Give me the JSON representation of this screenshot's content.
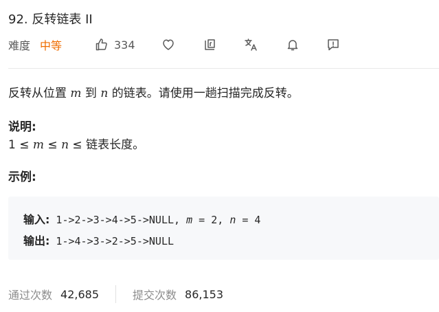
{
  "problem": {
    "title": "92. 反转链表 II",
    "difficulty_label": "难度",
    "difficulty_value": "中等",
    "likes": "334"
  },
  "toolbar_icons": [
    "thumbs-up-icon",
    "heart-icon",
    "share-icon",
    "translate-icon",
    "bell-icon",
    "feedback-icon"
  ],
  "colors": {
    "difficulty": "#ef6c00",
    "text": "#262626",
    "muted": "#8c8c8c",
    "code_bg": "#f7f8fa"
  },
  "description": {
    "prefix": "反转从位置 ",
    "m": "m",
    "middle": " 到 ",
    "n": "n",
    "suffix": " 的链表。请使用一趟扫描完成反转。"
  },
  "note": {
    "title": "说明:",
    "line_prefix": "1 ≤ ",
    "m": "m",
    "op": " ≤ ",
    "n": "n",
    "line_suffix": " ≤ 链表长度。"
  },
  "example": {
    "title": "示例:",
    "input_label": "输入:",
    "input_value": " 1->2->3->4->5->NULL, ",
    "input_m": "m",
    "input_m_eq": " = 2, ",
    "input_n": "n",
    "input_n_eq": " = 4",
    "output_label": "输出:",
    "output_value": " 1->4->3->2->5->NULL"
  },
  "stats": {
    "accepted_label": "通过次数",
    "accepted_value": "42,685",
    "submitted_label": "提交次数",
    "submitted_value": "86,153"
  }
}
